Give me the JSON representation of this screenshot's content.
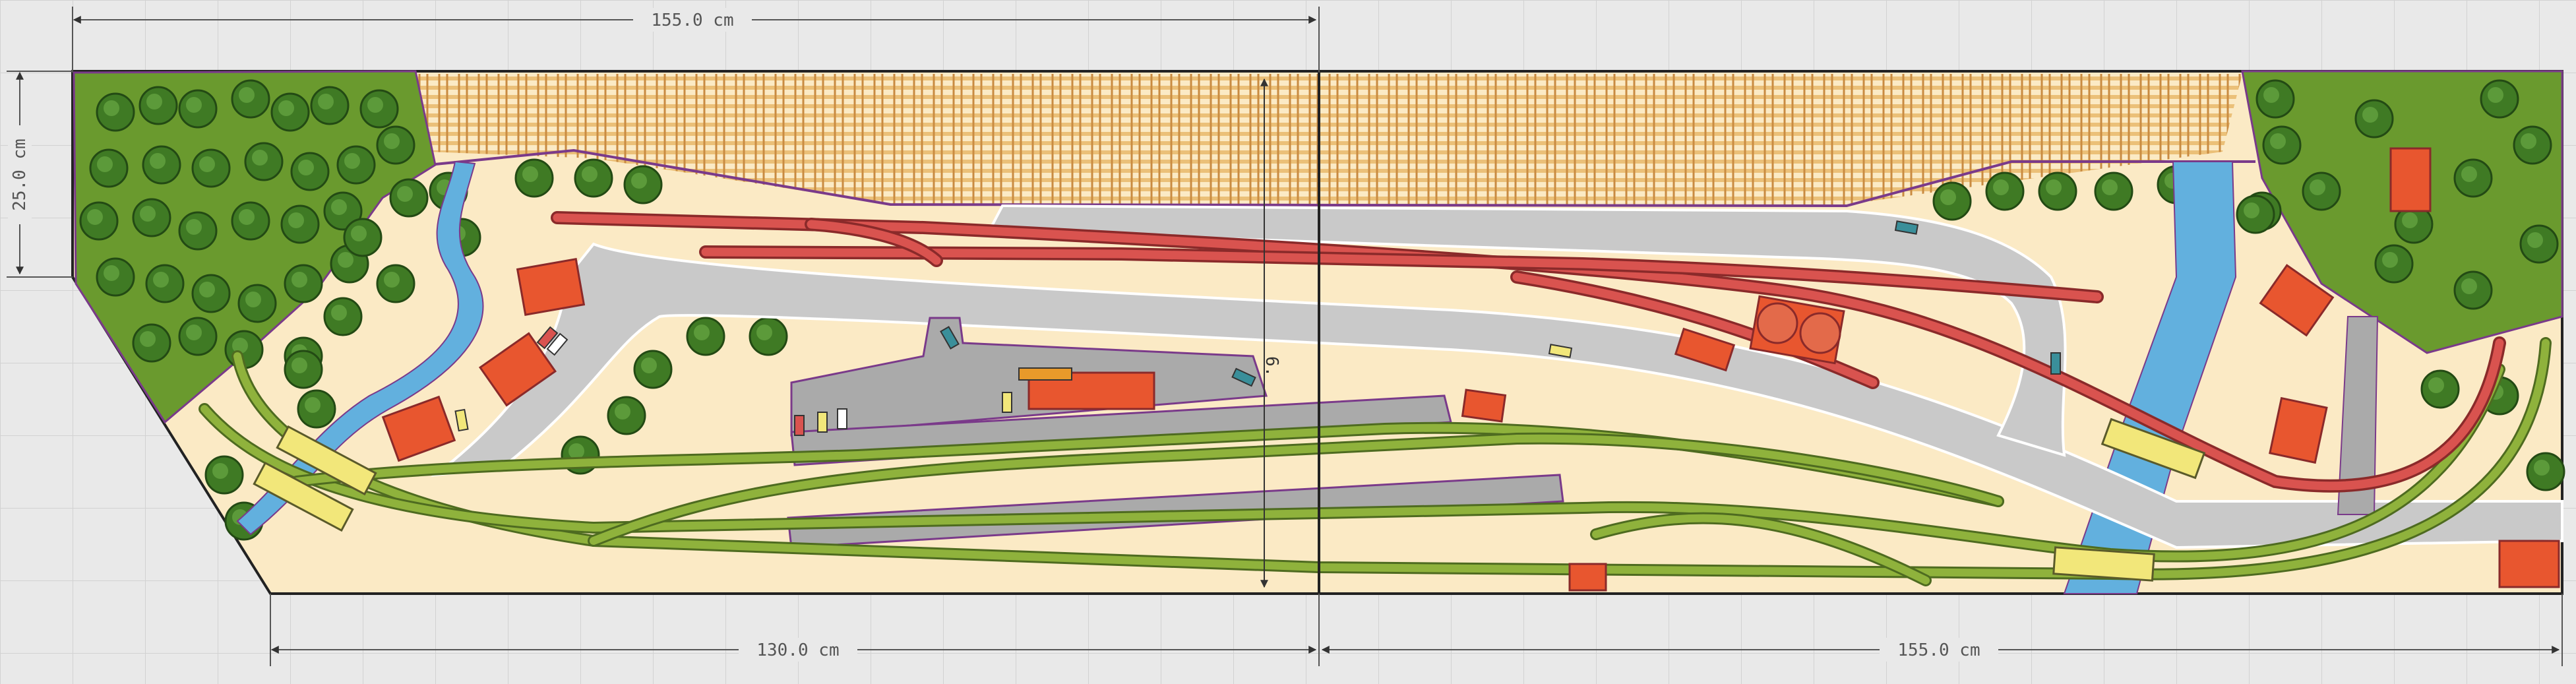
{
  "dimensions": {
    "top_width": "155.0 cm",
    "left_height": "25.0 cm",
    "bottom_left_width": "130.0 cm",
    "bottom_right_width": "155.0 cm"
  },
  "center_marker": "6.",
  "colors": {
    "background": "#e9e9e9",
    "grid": "#d2d2d2",
    "baseboard": "#fbeac5",
    "forest": "#6a9a2e",
    "tree": "#3f7a24",
    "water": "#62b0de",
    "road": "#c9c9c9",
    "platform": "#aaaaaa",
    "track_green": "#8fb23c",
    "track_red": "#d9534f",
    "building": "#e8562f",
    "bridge": "#f2e77a",
    "outline": "#7a3a8a"
  }
}
